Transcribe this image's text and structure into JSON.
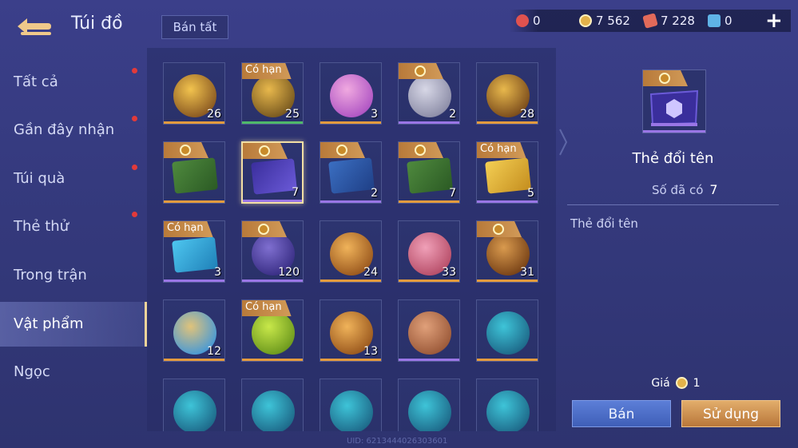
{
  "header": {
    "title": "Túi đồ",
    "sell_all_label": "Bán tất",
    "currencies": [
      {
        "icon": "red-gem-icon",
        "value": "0",
        "color": "#e0524f"
      },
      {
        "icon": "gold-coin-icon",
        "value": "7 562",
        "color": "#e3b24a"
      },
      {
        "icon": "red-voucher-icon",
        "value": "7 228",
        "color": "#e26a5a"
      },
      {
        "icon": "blue-ticket-icon",
        "value": "0",
        "color": "#5fb3e6"
      }
    ],
    "plus_label": "+"
  },
  "sidebar": {
    "items": [
      {
        "label": "Tất cả",
        "dot": true,
        "active": false
      },
      {
        "label": "Gần đây nhận",
        "dot": true,
        "active": false
      },
      {
        "label": "Túi quà",
        "dot": true,
        "active": false
      },
      {
        "label": "Thẻ thử",
        "dot": true,
        "active": false
      },
      {
        "label": "Trong trận",
        "dot": false,
        "active": false
      },
      {
        "label": "Vật phẩm",
        "dot": false,
        "active": true
      },
      {
        "label": "Ngọc",
        "dot": false,
        "active": false
      }
    ]
  },
  "grid": {
    "items": [
      {
        "name": "hero-card-item",
        "qty": "26",
        "tag": "",
        "coin": false,
        "bar": "#e39b3e",
        "art": "hero-triangle-icon"
      },
      {
        "name": "golden-wings-item",
        "qty": "25",
        "tag": "Có hạn",
        "coin": false,
        "bar": "#4fb96a",
        "art": "wings-icon"
      },
      {
        "name": "pink-orb-item",
        "qty": "3",
        "tag": "",
        "coin": false,
        "bar": "#e39b3e",
        "art": "pink-orb-icon"
      },
      {
        "name": "silver-emblem-item",
        "qty": "2",
        "tag": "",
        "coin": true,
        "bar": "#9a76e6",
        "art": "silver-orb-icon"
      },
      {
        "name": "magic-mirror-item",
        "qty": "28",
        "tag": "",
        "coin": false,
        "bar": "#e39b3e",
        "art": "mirror-icon"
      },
      {
        "name": "gold-x2-card-item",
        "qty": "",
        "tag": "",
        "coin": true,
        "bar": "#e39b3e",
        "art": "gold-x2-icon"
      },
      {
        "name": "rename-card-item",
        "qty": "7",
        "tag": "",
        "coin": true,
        "bar": "#9a76e6",
        "art": "rename-card-icon",
        "selected": true
      },
      {
        "name": "exp-x2-card-item",
        "qty": "2",
        "tag": "",
        "coin": true,
        "bar": "#9a76e6",
        "art": "exp-x2-icon"
      },
      {
        "name": "gold-x2-card-item-2",
        "qty": "7",
        "tag": "",
        "coin": true,
        "bar": "#e39b3e",
        "art": "gold-x2-icon"
      },
      {
        "name": "ticket-2026-gold-item",
        "qty": "5",
        "tag": "Có hạn",
        "coin": false,
        "bar": "#9a76e6",
        "art": "ticket-2026-icon"
      },
      {
        "name": "ticket-2026-blue-item",
        "qty": "3",
        "tag": "Có hạn",
        "coin": false,
        "bar": "#9a76e6",
        "art": "ticket-2026-blue-icon"
      },
      {
        "name": "knight-helmet-item",
        "qty": "120",
        "tag": "",
        "coin": true,
        "bar": "#9a76e6",
        "art": "helmet-icon"
      },
      {
        "name": "hero-crystal-item",
        "qty": "24",
        "tag": "",
        "coin": false,
        "bar": "#e39b3e",
        "art": "crystal-hero-icon"
      },
      {
        "name": "pink-scroll-item",
        "qty": "33",
        "tag": "",
        "coin": false,
        "bar": "#e39b3e",
        "art": "pink-scroll-icon"
      },
      {
        "name": "golden-chest-item",
        "qty": "31",
        "tag": "",
        "coin": true,
        "bar": "#e39b3e",
        "art": "chest-icon"
      },
      {
        "name": "blue-scroll-item",
        "qty": "12",
        "tag": "",
        "coin": false,
        "bar": "#e39b3e",
        "art": "blue-scroll-icon"
      },
      {
        "name": "heartbeat-item",
        "qty": "",
        "tag": "Có hạn",
        "coin": false,
        "bar": "#e39b3e",
        "art": "heartbeat-icon"
      },
      {
        "name": "hero-crystal-item-2",
        "qty": "13",
        "tag": "",
        "coin": false,
        "bar": "#e39b3e",
        "art": "crystal-hero-icon"
      },
      {
        "name": "copper-shard-item",
        "qty": "",
        "tag": "",
        "coin": false,
        "bar": "#9a76e6",
        "art": "shard-icon"
      },
      {
        "name": "hero-trophy-item",
        "qty": "",
        "tag": "",
        "coin": false,
        "bar": "#e39b3e",
        "art": "trophy-hero-icon"
      },
      {
        "name": "trophy-item-1",
        "qty": "",
        "tag": "",
        "coin": false,
        "bar": "",
        "art": "trophy-hero-icon"
      },
      {
        "name": "trophy-item-2",
        "qty": "",
        "tag": "",
        "coin": false,
        "bar": "",
        "art": "trophy-hero-icon"
      },
      {
        "name": "trophy-item-3",
        "qty": "",
        "tag": "",
        "coin": false,
        "bar": "",
        "art": "trophy-hero-icon"
      },
      {
        "name": "trophy-item-4",
        "qty": "",
        "tag": "",
        "coin": false,
        "bar": "",
        "art": "trophy-hero-icon"
      },
      {
        "name": "trophy-item-5",
        "qty": "",
        "tag": "",
        "coin": false,
        "bar": "",
        "art": "trophy-hero-icon"
      }
    ]
  },
  "detail": {
    "name": "Thẻ đổi tên",
    "owned_label": "Số đã có",
    "owned_value": "7",
    "description": "Thẻ đổi tên",
    "price_label": "Giá",
    "price_value": "1",
    "sell_label": "Bán",
    "use_label": "Sử dụng"
  },
  "uid": "UID: 6213444026303601"
}
